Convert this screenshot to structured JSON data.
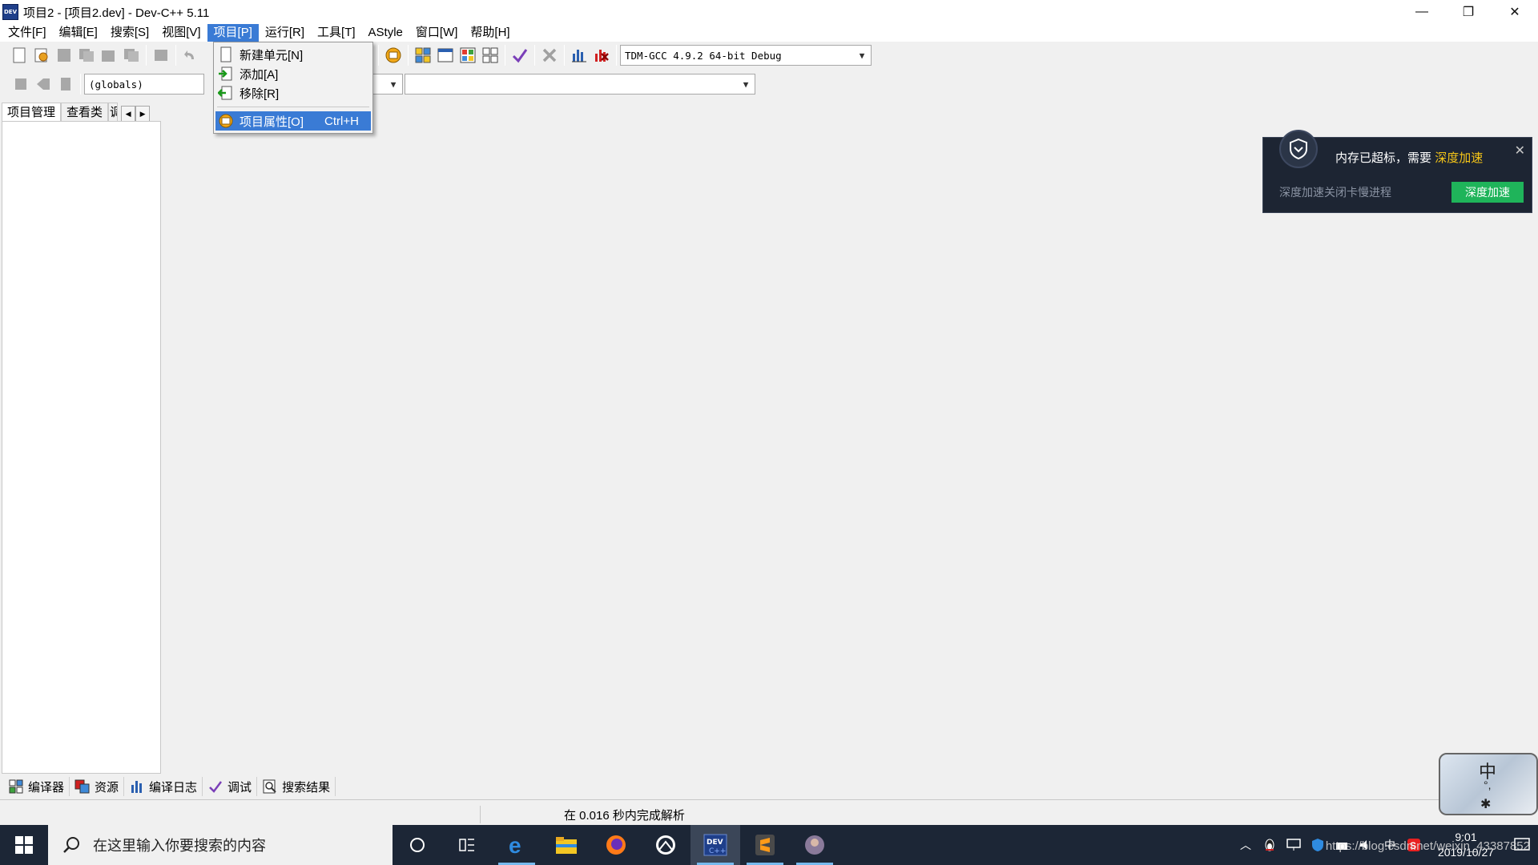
{
  "window": {
    "title": "项目2 - [项目2.dev] - Dev-C++ 5.11",
    "app_icon_text": "DEV",
    "minimize": "—",
    "restore": "❐",
    "close": "✕"
  },
  "menubar": {
    "items": [
      "文件[F]",
      "编辑[E]",
      "搜索[S]",
      "视图[V]",
      "项目[P]",
      "运行[R]",
      "工具[T]",
      "AStyle",
      "窗口[W]",
      "帮助[H]"
    ],
    "active_index": 4
  },
  "toolbar": {
    "compiler_select": "TDM-GCC 4.9.2 64-bit Debug",
    "scope_select": "(globals)",
    "member_select": "",
    "member_select2": ""
  },
  "project_menu": {
    "items": [
      {
        "label": "新建单元[N]",
        "shortcut": "",
        "icon": "new-file-icon"
      },
      {
        "label": "添加[A]",
        "shortcut": "",
        "icon": "add-to-project-icon"
      },
      {
        "label": "移除[R]",
        "shortcut": "",
        "icon": "remove-from-project-icon"
      },
      {
        "label": "项目属性[O]",
        "shortcut": "Ctrl+H",
        "icon": "project-options-icon"
      }
    ],
    "highlighted_index": 3
  },
  "left_tabs": {
    "tab1": "项目管理",
    "tab2": "查看类",
    "tab3_partial": "调"
  },
  "bottom_tabs": [
    {
      "label": "编译器",
      "icon": "compiler-icon"
    },
    {
      "label": "资源",
      "icon": "resources-icon"
    },
    {
      "label": "编译日志",
      "icon": "compile-log-icon"
    },
    {
      "label": "调试",
      "icon": "debug-icon"
    },
    {
      "label": "搜索结果",
      "icon": "search-results-icon"
    }
  ],
  "statusbar": {
    "message": "在 0.016 秒内完成解析"
  },
  "notification": {
    "title_prefix": "内存已超标，需要",
    "title_highlight": "深度加速",
    "subtitle": "深度加速关闭卡慢进程",
    "button": "深度加速",
    "close": "✕"
  },
  "ime": {
    "mode": "中",
    "punct": "°,",
    "extra": "✱"
  },
  "taskbar": {
    "search_placeholder": "在这里输入你要搜索的内容",
    "clock_time": "9:01",
    "clock_date": "2019/10/27",
    "watermark": "https://blog.csdn.net/weixin_43387852",
    "tray_lang": "中"
  },
  "colors": {
    "menu_highlight": "#3a7bd5",
    "taskbar_bg": "#1c2636",
    "notify_bg": "#1d2533",
    "notify_button": "#1fb45a",
    "notify_highlight": "#f5c518"
  }
}
